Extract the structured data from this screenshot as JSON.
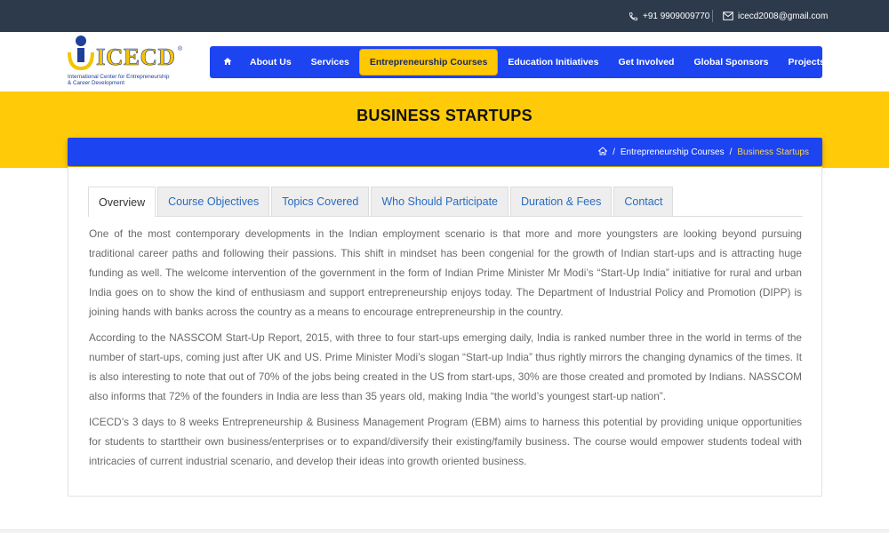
{
  "topbar": {
    "phone": "+91 9909009770",
    "email": "icecd2008@gmail.com"
  },
  "logo": {
    "word": "ICECD",
    "reg": "®",
    "sub_line1": "International Center for Entrepreneurship",
    "sub_line2": "& Career Development"
  },
  "nav": {
    "items": [
      {
        "label": "About Us"
      },
      {
        "label": "Services"
      },
      {
        "label": "Entrepreneurship Courses"
      },
      {
        "label": "Education Initiatives"
      },
      {
        "label": "Get Involved"
      },
      {
        "label": "Global Sponsors"
      },
      {
        "label": "Projects"
      }
    ]
  },
  "page": {
    "title": "BUSINESS STARTUPS"
  },
  "breadcrumb": {
    "sep": "/",
    "parent": "Entrepreneurship Courses",
    "current": "Business Startups"
  },
  "tabs": [
    {
      "label": "Overview"
    },
    {
      "label": "Course Objectives"
    },
    {
      "label": "Topics Covered"
    },
    {
      "label": "Who Should Participate"
    },
    {
      "label": "Duration & Fees"
    },
    {
      "label": "Contact"
    }
  ],
  "content": {
    "paragraphs": [
      "One of the most contemporary developments in the Indian employment scenario is that more and more youngsters are looking beyond pursuing traditional career paths and following their passions. This shift in mindset has been congenial for the growth of Indian start-ups and is attracting huge funding as well. The welcome intervention of the government in the form of Indian Prime Minister Mr Modi’s “Start-Up India” initiative for rural and urban India goes on to show the kind of enthusiasm and support entrepreneurship enjoys today. The Department of Industrial Policy and Promotion (DIPP) is joining hands with banks across the country as a means to encourage entrepreneurship in the country.",
      "According to the NASSCOM Start-Up Report, 2015, with three to four start-ups emerging daily, India is ranked number three in the world in terms of the number of start-ups, coming just after UK and US. Prime Minister Modi’s slogan “Start-up India” thus rightly mirrors the changing dynamics of the times. It is also interesting to note that out of 70% of the jobs being created in the US from start-ups, 30% are those created and promoted by Indians. NASSCOM also informs that 72% of the founders in India are less than 35 years old, making India “the world’s youngest start-up nation”.",
      "ICECD’s 3 days to 8 weeks Entrepreneurship & Business Management Program (EBM) aims to harness this potential by providing unique opportunities for students to starttheir own business/enterprises or to expand/diversify their existing/family business. The course would empower students todeal with intricacies of current industrial scenario, and develop their ideas into growth oriented business."
    ]
  },
  "colors": {
    "topbar": "#2d3a4b",
    "nav_blue": "#1c44f0",
    "accent_yellow": "#ffca08",
    "link_blue": "#2a6cc0"
  }
}
